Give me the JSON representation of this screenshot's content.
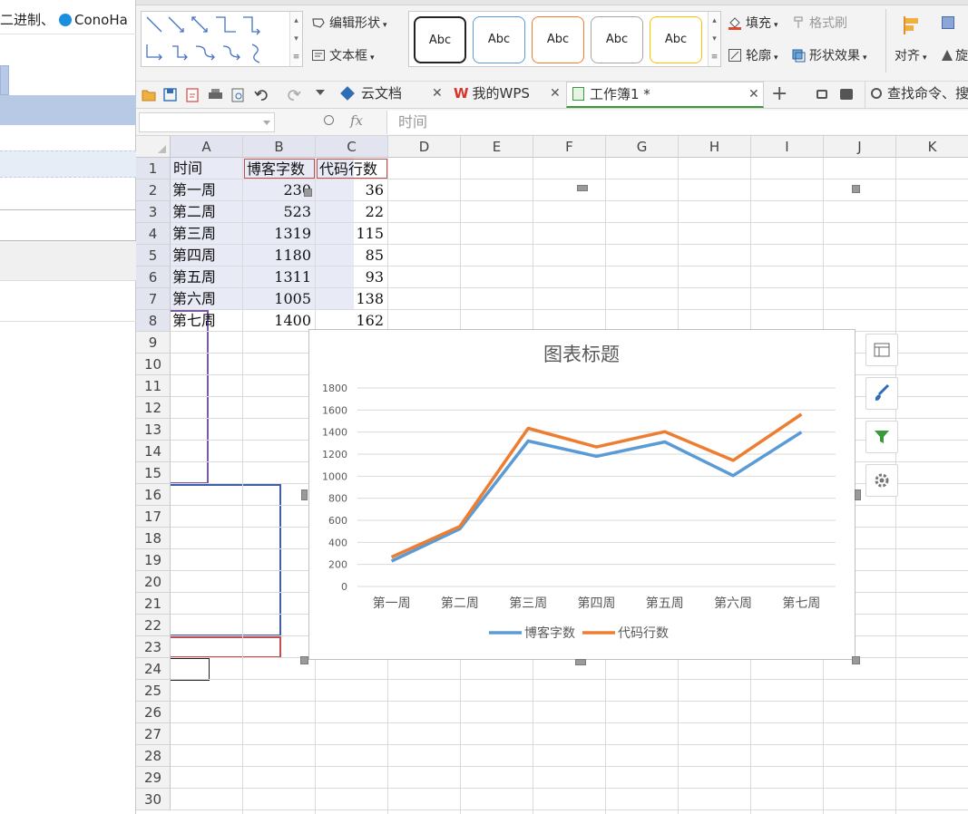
{
  "left_window": {
    "bookmark_1": "二进制、",
    "bookmark_2": "ConoHa"
  },
  "ribbon": {
    "edit_shape": "编辑形状",
    "text_box": "文本框",
    "style_label": "Abc",
    "fill": "填充",
    "format_painter": "格式刷",
    "outline": "轮廓",
    "shape_effects": "形状效果",
    "align": "对齐",
    "rotate_partial": "旋"
  },
  "tabs": [
    {
      "label": "云文档"
    },
    {
      "label": "我的WPS"
    },
    {
      "label": "工作簿1 *"
    }
  ],
  "search": {
    "label": "查找命令、搜"
  },
  "formula_bar": {
    "fx": "fx",
    "content": "时间"
  },
  "columns": [
    "A",
    "B",
    "C",
    "D",
    "E",
    "F",
    "G",
    "H",
    "I",
    "J",
    "K"
  ],
  "rows": [
    "1",
    "2",
    "3",
    "4",
    "5",
    "6",
    "7",
    "8",
    "9",
    "10",
    "11",
    "12",
    "13",
    "14",
    "15",
    "16",
    "17",
    "18",
    "19",
    "20",
    "21",
    "22",
    "23",
    "24",
    "25",
    "26",
    "27",
    "28",
    "29",
    "30"
  ],
  "table": {
    "headers": [
      "时间",
      "博客字数",
      "代码行数"
    ],
    "rows": [
      [
        "第一周",
        "230",
        "36"
      ],
      [
        "第二周",
        "523",
        "22"
      ],
      [
        "第三周",
        "1319",
        "115"
      ],
      [
        "第四周",
        "1180",
        "85"
      ],
      [
        "第五周",
        "1311",
        "93"
      ],
      [
        "第六周",
        "1005",
        "138"
      ],
      [
        "第七周",
        "1400",
        "162"
      ]
    ]
  },
  "chart_data": {
    "type": "line",
    "stacked": true,
    "title": "图表标题",
    "categories": [
      "第一周",
      "第二周",
      "第三周",
      "第四周",
      "第五周",
      "第六周",
      "第七周"
    ],
    "series": [
      {
        "name": "博客字数",
        "values": [
          230,
          523,
          1319,
          1180,
          1311,
          1005,
          1400
        ],
        "color": "#5b9bd5"
      },
      {
        "name": "代码行数",
        "values": [
          36,
          22,
          115,
          85,
          93,
          138,
          162
        ],
        "color": "#ed7d31"
      }
    ],
    "yticks": [
      "0",
      "200",
      "400",
      "600",
      "800",
      "1000",
      "1200",
      "1400",
      "1600",
      "1800"
    ],
    "ylim": [
      0,
      1800
    ],
    "grid": true,
    "legend": "bottom"
  },
  "colors": {
    "selection_fill": "#e8eaf6",
    "header_fill": "#f2f2f2",
    "accent_green": "#3a9a3a"
  }
}
